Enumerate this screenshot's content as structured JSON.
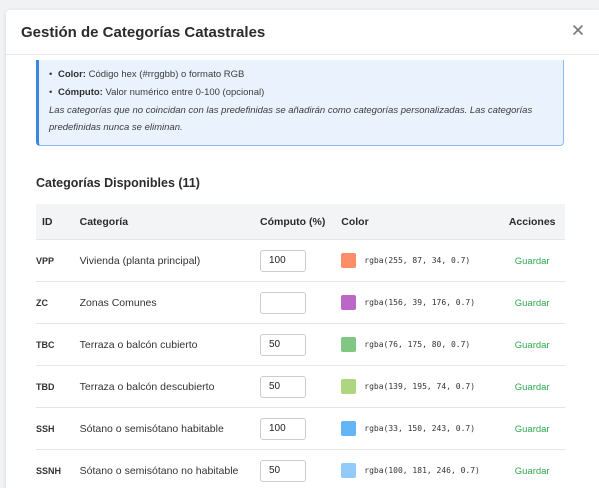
{
  "modal": {
    "title": "Gestión de Categorías Catastrales",
    "close_icon": "close-icon"
  },
  "info": {
    "items": [
      {
        "label": "Color:",
        "text": "Código hex (#rrggbb) o formato RGB"
      },
      {
        "label": "Cómputo:",
        "text": "Valor numérico entre 0-100 (opcional)"
      }
    ],
    "note": "Las categorías que no coincidan con las predefinidas se añadirán como categorías personalizadas. Las categorías predefinidas nunca se eliminan."
  },
  "section": {
    "title": "Categorías Disponibles (11)"
  },
  "table": {
    "headers": {
      "id": "ID",
      "category": "Categoría",
      "compute": "Cómputo (%)",
      "color": "Color",
      "actions": "Acciones"
    },
    "rows": [
      {
        "id": "VPP",
        "category": "Vivienda (planta principal)",
        "compute": "100",
        "color_text": "rgba(255, 87, 34, 0.7)",
        "swatch": "#fd8e6a",
        "action": "Guardar"
      },
      {
        "id": "ZC",
        "category": "Zonas Comunes",
        "compute": "",
        "color_text": "rgba(156, 39, 176, 0.7)",
        "swatch": "#ba67c8",
        "action": "Guardar"
      },
      {
        "id": "TBC",
        "category": "Terraza o balcón cubierto",
        "compute": "50",
        "color_text": "rgba(76, 175, 80, 0.7)",
        "swatch": "#81c784",
        "action": "Guardar"
      },
      {
        "id": "TBD",
        "category": "Terraza o balcón descubierto",
        "compute": "50",
        "color_text": "rgba(139, 195, 74, 0.7)",
        "swatch": "#aed580",
        "action": "Guardar"
      },
      {
        "id": "SSH",
        "category": "Sótano o semisótano habitable",
        "compute": "100",
        "color_text": "rgba(33, 150, 243, 0.7)",
        "swatch": "#64b5f6",
        "action": "Guardar"
      },
      {
        "id": "SSNH",
        "category": "Sótano o semisótano no habitable",
        "compute": "50",
        "color_text": "rgba(100, 181, 246, 0.7)",
        "swatch": "#92cbf9",
        "action": "Guardar"
      }
    ]
  },
  "colors": {
    "accent_blue": "#3d86de",
    "save_green": "#2fa84f"
  }
}
